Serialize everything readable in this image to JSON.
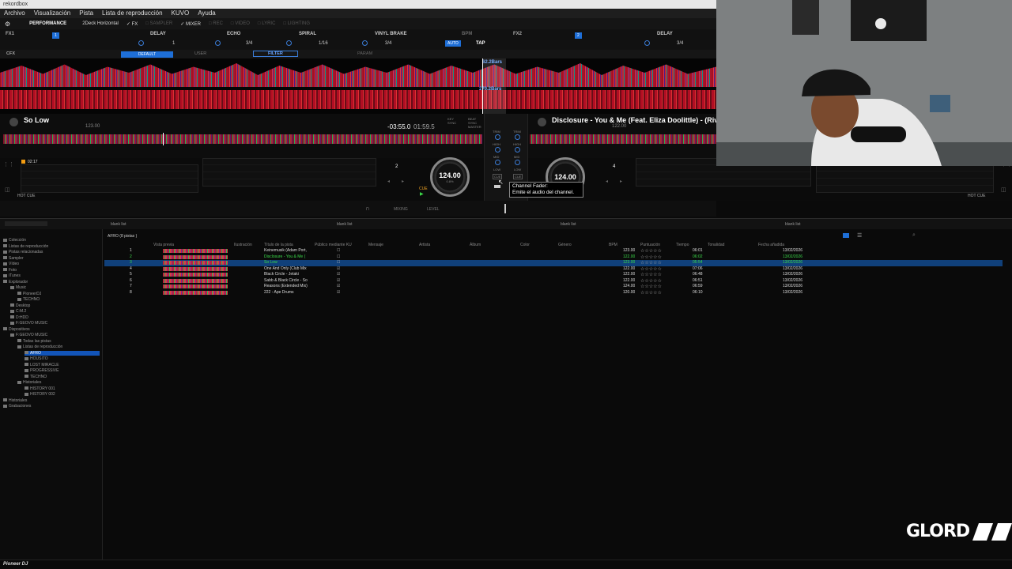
{
  "window": {
    "title": "rekordbox"
  },
  "menu": [
    "Archivo",
    "Visualización",
    "Pista",
    "Lista de reproducción",
    "KUVO",
    "Ayuda"
  ],
  "toolbar": {
    "mode": "PERFORMANCE",
    "layout": "2Deck Horizontal",
    "fx": "FX",
    "sampler": "SAMPLER",
    "mixer": "MIXER",
    "rec": "REC",
    "video": "VIDEO",
    "lyric": "LYRIC",
    "lighting": "LIGHTING"
  },
  "fx1": {
    "label": "FX1",
    "effects": [
      "DELAY",
      "ECHO",
      "SPIRAL",
      "VINYL BRAKE"
    ],
    "beats": [
      "1",
      "3/4",
      "1/16",
      "3/4"
    ],
    "bpm_label": "BPM",
    "auto": "AUTO",
    "tap": "TAP"
  },
  "fx2": {
    "label": "FX2",
    "effects": [
      "DELAY"
    ],
    "beats": [
      "3/4"
    ]
  },
  "cfx": {
    "label": "CFX",
    "default": "DEFAULT",
    "user": "USER",
    "filter": "FILTER",
    "param": "PARAM"
  },
  "waveform": {
    "bpm_top": "62.2Bars",
    "bpm_bottom": "270.2Bars"
  },
  "deck1": {
    "title": "So Low",
    "bpm": "123.00",
    "remaining": "-03:55.0",
    "elapsed": "01:59.5",
    "number": "2",
    "jog_bpm": "124.00",
    "jog_pitch": "0.8%",
    "cue_time": "02:17",
    "hot_cue": "HOT CUE",
    "key_sync": "KEY SYNC",
    "beat_sync": "BEAT SYNC MASTER"
  },
  "deck2": {
    "title": "Disclosure - You & Me (Feat. Eliza Doolittle) - (Rivo Ext",
    "bpm": "122.00",
    "number": "4",
    "jog_bpm": "124.00",
    "hot_cue": "HOT CUE"
  },
  "mixer": {
    "trim": "TRIM",
    "high": "HIGH",
    "mid": "MID",
    "low": "LOW",
    "cue": "CUE"
  },
  "tooltip": {
    "title": "Channel Fader:",
    "body": "Emite el audio del channel."
  },
  "transport": {
    "mixing": "MIXING",
    "level": "LEVEL"
  },
  "browser": {
    "panes": [
      "blank list",
      "blank list",
      "blank list",
      "blank list"
    ],
    "playlist_title": "AFRO (8 pistas )",
    "columns": [
      "Vista previa",
      "Ilustración",
      "Título de la pista",
      "Público mediante KU",
      "Mensaje",
      "Artista",
      "Álbum",
      "Color",
      "Género",
      "BPM",
      "Puntuación",
      "Tiempo",
      "Tonalidad",
      "Fecha añadida"
    ],
    "tracks": [
      {
        "n": "1",
        "title": "Keinemusik (Adam Port,",
        "bpm": "123.00",
        "time": "06:01",
        "date": "13/02/2026",
        "checked": false
      },
      {
        "n": "2",
        "title": "Disclosure - You & Me (",
        "bpm": "122.00",
        "time": "06:02",
        "date": "13/02/2026",
        "checked": false
      },
      {
        "n": "3",
        "title": "So Low",
        "bpm": "123.00",
        "time": "05:54",
        "date": "13/02/2026",
        "checked": false
      },
      {
        "n": "4",
        "title": "One And Only (Club Mix",
        "bpm": "122.00",
        "time": "07:06",
        "date": "13/02/2026",
        "checked": true
      },
      {
        "n": "5",
        "title": "Black Circle - Jetaki",
        "bpm": "122.00",
        "time": "06:48",
        "date": "13/02/2026",
        "checked": true
      },
      {
        "n": "6",
        "title": "Sabb & Black Circle - So",
        "bpm": "122.00",
        "time": "06:51",
        "date": "13/02/2026",
        "checked": true
      },
      {
        "n": "7",
        "title": "Reasons (Extended Mix)",
        "bpm": "124.00",
        "time": "06:59",
        "date": "13/02/2026",
        "checked": true
      },
      {
        "n": "8",
        "title": "222 - Ape Drums",
        "bpm": "120.00",
        "time": "06:10",
        "date": "13/02/2026",
        "checked": true
      }
    ]
  },
  "tree": [
    {
      "label": "Colección",
      "indent": 1
    },
    {
      "label": "Listas de reproducción",
      "indent": 1
    },
    {
      "label": "Pistas relacionadas",
      "indent": 1
    },
    {
      "label": "Sampler",
      "indent": 1
    },
    {
      "label": "Vídeo",
      "indent": 1
    },
    {
      "label": "Foto",
      "indent": 1
    },
    {
      "label": "iTunes",
      "indent": 1
    },
    {
      "label": "Explorador",
      "indent": 1
    },
    {
      "label": "Music",
      "indent": 2
    },
    {
      "label": "PioneerDJ",
      "indent": 3
    },
    {
      "label": "TECHNO",
      "indent": 3
    },
    {
      "label": "Desktop",
      "indent": 2
    },
    {
      "label": "C:M.2",
      "indent": 2
    },
    {
      "label": "D:HDD",
      "indent": 2
    },
    {
      "label": "F:GEOVO MUSIC",
      "indent": 2
    },
    {
      "label": "Dispositivos",
      "indent": 1
    },
    {
      "label": "F:GEOVO MUSIC",
      "indent": 2
    },
    {
      "label": "Todas las pistas",
      "indent": 3
    },
    {
      "label": "Listas de reproducción",
      "indent": 3
    },
    {
      "label": "AFRO",
      "indent": 4,
      "selected": true
    },
    {
      "label": "HOUSITO",
      "indent": 4
    },
    {
      "label": "LOST MIRACLE",
      "indent": 4
    },
    {
      "label": "PROGRESSIVE",
      "indent": 4
    },
    {
      "label": "TECHNO",
      "indent": 4
    },
    {
      "label": "Historiales",
      "indent": 3
    },
    {
      "label": "HISTORY 001",
      "indent": 4
    },
    {
      "label": "HISTORY 002",
      "indent": 4
    },
    {
      "label": "Historiales",
      "indent": 1
    },
    {
      "label": "Grabaciones",
      "indent": 1
    }
  ],
  "status": {
    "brand": "Pioneer DJ"
  },
  "watermark": {
    "text": "GLORD"
  },
  "colors": {
    "accent": "#1e6fd8",
    "green": "#3cdc4a",
    "waveform_red": "#d01028"
  }
}
